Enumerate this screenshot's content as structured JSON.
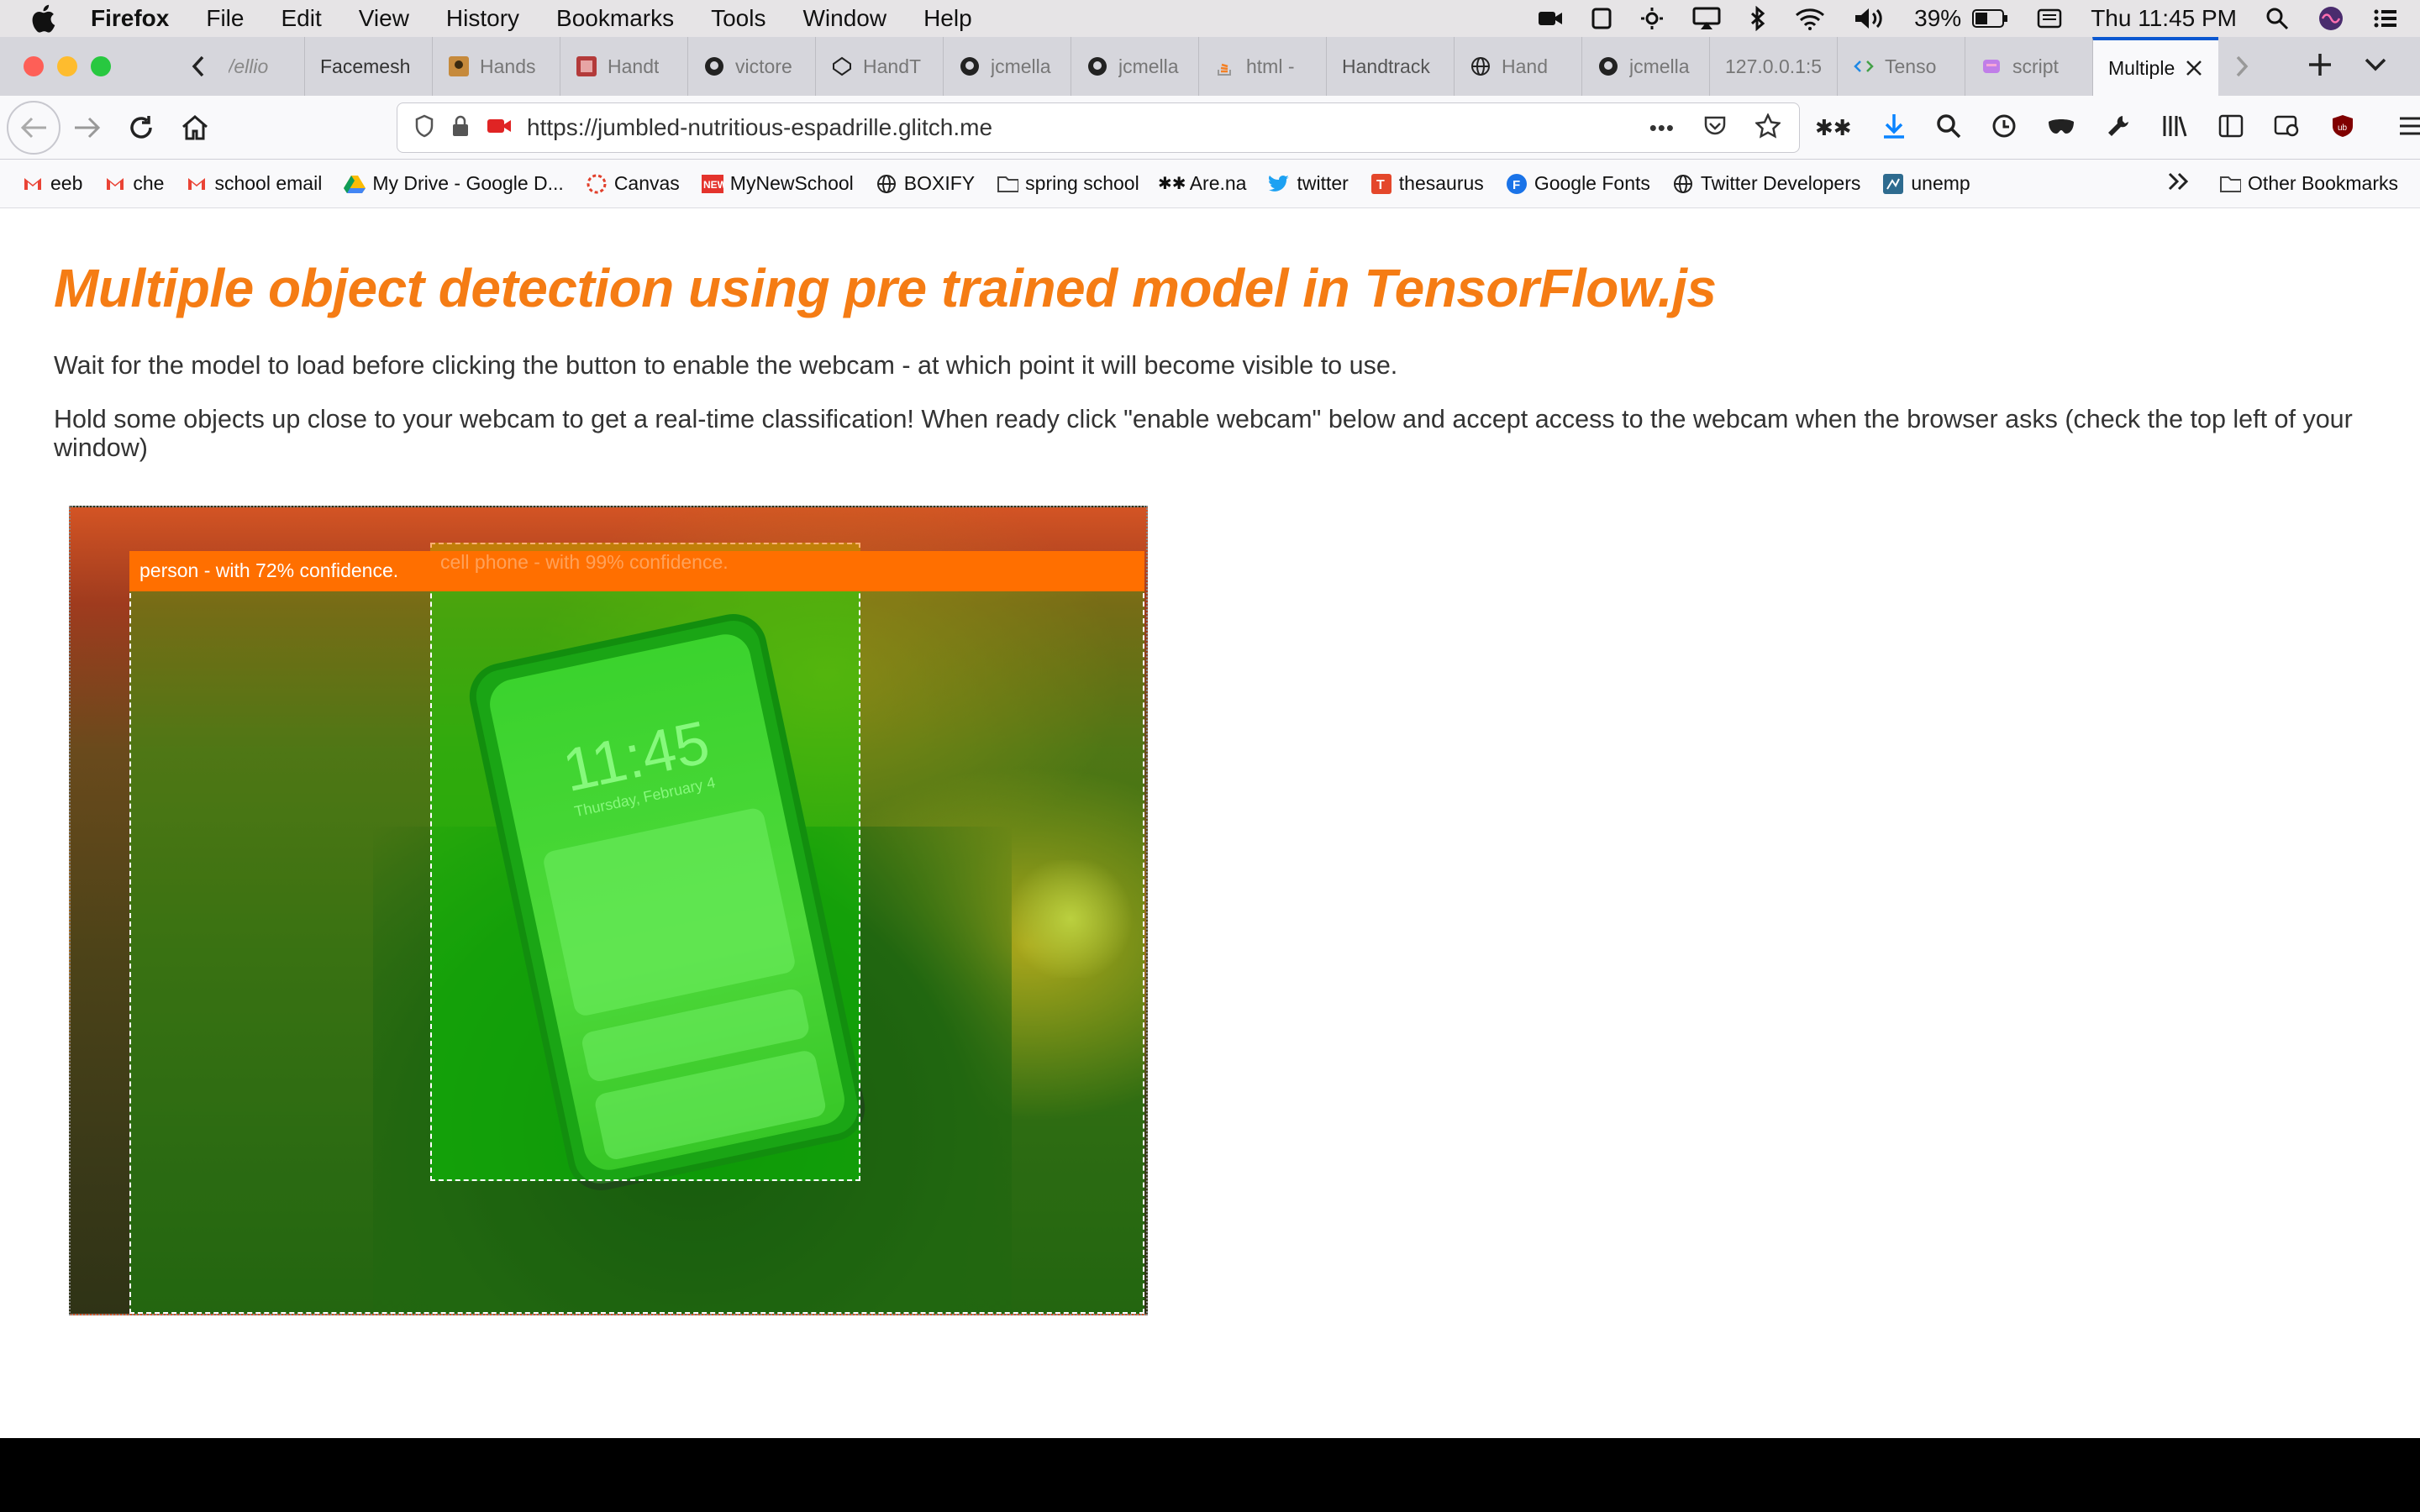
{
  "menubar": {
    "app_name": "Firefox",
    "menus": [
      "File",
      "Edit",
      "View",
      "History",
      "Bookmarks",
      "Tools",
      "Window",
      "Help"
    ],
    "battery": "39%",
    "clock": "Thu 11:45 PM"
  },
  "tabs": [
    {
      "label": "/ellio",
      "icon": "none"
    },
    {
      "label": "Facemesh",
      "icon": "none"
    },
    {
      "label": "Hands",
      "icon": "image-icon"
    },
    {
      "label": "Handt",
      "icon": "image-icon"
    },
    {
      "label": "victore",
      "icon": "github-icon"
    },
    {
      "label": "HandT",
      "icon": "codepen-icon"
    },
    {
      "label": "jcmella",
      "icon": "github-icon"
    },
    {
      "label": "jcmella",
      "icon": "github-icon"
    },
    {
      "label": "html -",
      "icon": "stackoverflow-icon"
    },
    {
      "label": "Handtrack",
      "icon": "none"
    },
    {
      "label": "Hand",
      "icon": "globe-icon"
    },
    {
      "label": "jcmella",
      "icon": "github-icon"
    },
    {
      "label": "127.0.0.1:5",
      "icon": "none"
    },
    {
      "label": "Tenso",
      "icon": "code-icon"
    },
    {
      "label": "script",
      "icon": "glitch-icon"
    }
  ],
  "active_tab": {
    "label": "Multiple"
  },
  "navbar": {
    "url": "https://jumbled-nutritious-espadrille.glitch.me",
    "more_label": "•••"
  },
  "bookmarks": [
    {
      "label": "eeb",
      "icon": "gmail-icon"
    },
    {
      "label": "che",
      "icon": "gmail-icon"
    },
    {
      "label": "school email",
      "icon": "gmail-icon"
    },
    {
      "label": "My Drive - Google D...",
      "icon": "drive-icon"
    },
    {
      "label": "Canvas",
      "icon": "canvas-icon"
    },
    {
      "label": "MyNewSchool",
      "icon": "newschool-icon"
    },
    {
      "label": "BOXIFY",
      "icon": "globe-icon"
    },
    {
      "label": "spring school",
      "icon": "folder-icon"
    },
    {
      "label": "Are.na",
      "icon": "arena-icon"
    },
    {
      "label": "twitter",
      "icon": "twitter-icon"
    },
    {
      "label": "thesaurus",
      "icon": "thesaurus-icon"
    },
    {
      "label": "Google Fonts",
      "icon": "googlefonts-icon"
    },
    {
      "label": "Twitter Developers",
      "icon": "globe-icon"
    },
    {
      "label": "unemp",
      "icon": "unemp-icon"
    }
  ],
  "other_bookmarks": "Other Bookmarks",
  "page": {
    "title": "Multiple object detection using pre trained model in TensorFlow.js",
    "para1": "Wait for the model to load before clicking the button to enable the webcam - at which point it will become visible to use.",
    "para2": "Hold some objects up close to your webcam to get a real-time classification! When ready click \"enable webcam\" below and accept access to the webcam when the browser asks (check the top left of your window)",
    "detections": [
      {
        "label": "person - with 72% confidence."
      },
      {
        "label": "cell phone - with 99% confidence."
      }
    ],
    "phone_clock": "11:45",
    "phone_date": "Thursday, February 4"
  },
  "colors": {
    "title": "#f57c14",
    "label_bg": "#ff6f00",
    "highlight": "#00ff00",
    "active_tab_accent": "#0a57d0"
  }
}
